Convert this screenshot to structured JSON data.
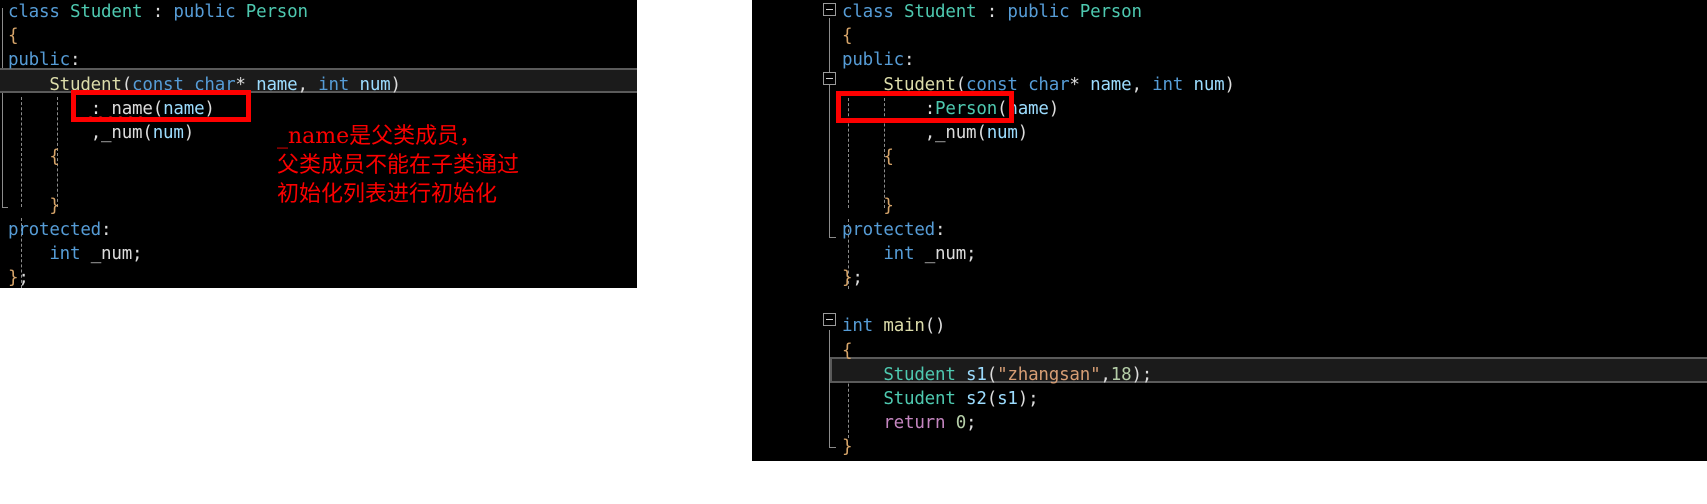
{
  "colors": {
    "background": "#000000",
    "annotation_red": "#fc0000",
    "box_red": "#fe0000",
    "keyword_blue": "#569cd6",
    "type_teal": "#4ec9b0",
    "function_yellow": "#dcdcaa",
    "variable_lightblue": "#9cdcfe",
    "string_orange": "#d69d74",
    "number_green": "#b5cea8",
    "control_purple": "#c586c0",
    "brace_tan": "#d7a56a",
    "plain_text": "#dcdcdc",
    "current_line_border": "#5a5a5a"
  },
  "left_panel": {
    "name": "code-editor-error-version",
    "lines": [
      {
        "indent": 0,
        "tokens": [
          {
            "t": "class",
            "c": "t-key"
          },
          {
            "t": " ",
            "c": "t-white"
          },
          {
            "t": "Student",
            "c": "t-type"
          },
          {
            "t": " ",
            "c": "t-white"
          },
          {
            "t": ":",
            "c": "t-plain"
          },
          {
            "t": " ",
            "c": "t-white"
          },
          {
            "t": "public",
            "c": "t-key"
          },
          {
            "t": " ",
            "c": "t-white"
          },
          {
            "t": "Person",
            "c": "t-type"
          }
        ]
      },
      {
        "indent": 0,
        "tokens": [
          {
            "t": "{",
            "c": "t-brace"
          }
        ]
      },
      {
        "indent": 0,
        "tokens": [
          {
            "t": "public",
            "c": "t-key"
          },
          {
            "t": ":",
            "c": "t-plain"
          }
        ]
      },
      {
        "indent": 0,
        "tokens": [
          {
            "t": "    ",
            "c": "t-white"
          },
          {
            "t": "Student",
            "c": "t-func"
          },
          {
            "t": "(",
            "c": "t-paren"
          },
          {
            "t": "const",
            "c": "t-key"
          },
          {
            "t": " ",
            "c": "t-white"
          },
          {
            "t": "char",
            "c": "t-key"
          },
          {
            "t": "*",
            "c": "t-plain"
          },
          {
            "t": " ",
            "c": "t-white"
          },
          {
            "t": "name",
            "c": "t-var"
          },
          {
            "t": ",",
            "c": "t-plain"
          },
          {
            "t": " ",
            "c": "t-white"
          },
          {
            "t": "int",
            "c": "t-key"
          },
          {
            "t": " ",
            "c": "t-white"
          },
          {
            "t": "num",
            "c": "t-var"
          },
          {
            "t": ")",
            "c": "t-paren"
          }
        ]
      },
      {
        "indent": 0,
        "tokens": [
          {
            "t": "        ",
            "c": "t-white"
          },
          {
            "t": ":",
            "c": "t-plain"
          },
          {
            "t": "_name",
            "c": "t-member"
          },
          {
            "t": "(",
            "c": "t-paren"
          },
          {
            "t": "name",
            "c": "t-var"
          },
          {
            "t": ")",
            "c": "t-paren"
          }
        ]
      },
      {
        "indent": 0,
        "tokens": [
          {
            "t": "        ",
            "c": "t-white"
          },
          {
            "t": ",",
            "c": "t-plain"
          },
          {
            "t": "_num",
            "c": "t-member"
          },
          {
            "t": "(",
            "c": "t-paren"
          },
          {
            "t": "num",
            "c": "t-var"
          },
          {
            "t": ")",
            "c": "t-paren"
          }
        ]
      },
      {
        "indent": 0,
        "tokens": [
          {
            "t": "    ",
            "c": "t-white"
          },
          {
            "t": "{",
            "c": "t-brace"
          }
        ]
      },
      {
        "indent": 0,
        "tokens": [
          {
            "t": "",
            "c": "t-white"
          }
        ]
      },
      {
        "indent": 0,
        "tokens": [
          {
            "t": "    ",
            "c": "t-white"
          },
          {
            "t": "}",
            "c": "t-brace"
          }
        ]
      },
      {
        "indent": 0,
        "tokens": [
          {
            "t": "protected",
            "c": "t-key"
          },
          {
            "t": ":",
            "c": "t-plain"
          }
        ]
      },
      {
        "indent": 0,
        "tokens": [
          {
            "t": "    ",
            "c": "t-white"
          },
          {
            "t": "int",
            "c": "t-key"
          },
          {
            "t": " ",
            "c": "t-white"
          },
          {
            "t": "_num",
            "c": "t-member"
          },
          {
            "t": ";",
            "c": "t-plain"
          }
        ]
      },
      {
        "indent": 0,
        "tokens": [
          {
            "t": "}",
            "c": "t-brace"
          },
          {
            "t": ";",
            "c": "t-plain"
          }
        ]
      }
    ],
    "highlighted_line_index": 3,
    "error_token": "_name",
    "red_box_target_line_index": 4,
    "red_box_target_text": ":_name(name)"
  },
  "annotation": {
    "name": "chinese-error-explanation",
    "line1": "_name是父类成员，",
    "line2": "父类成员不能在子类通过",
    "line3": "初始化列表进行初始化"
  },
  "right_panel": {
    "name": "code-editor-fixed-version",
    "lines": [
      {
        "tokens": [
          {
            "t": "class",
            "c": "t-key"
          },
          {
            "t": " ",
            "c": "t-white"
          },
          {
            "t": "Student",
            "c": "t-type"
          },
          {
            "t": " ",
            "c": "t-white"
          },
          {
            "t": ":",
            "c": "t-plain"
          },
          {
            "t": " ",
            "c": "t-white"
          },
          {
            "t": "public",
            "c": "t-key"
          },
          {
            "t": " ",
            "c": "t-white"
          },
          {
            "t": "Person",
            "c": "t-type"
          }
        ]
      },
      {
        "tokens": [
          {
            "t": "{",
            "c": "t-brace"
          }
        ]
      },
      {
        "tokens": [
          {
            "t": "public",
            "c": "t-key"
          },
          {
            "t": ":",
            "c": "t-plain"
          }
        ]
      },
      {
        "tokens": [
          {
            "t": "    ",
            "c": "t-white"
          },
          {
            "t": "Student",
            "c": "t-func"
          },
          {
            "t": "(",
            "c": "t-paren"
          },
          {
            "t": "const",
            "c": "t-key"
          },
          {
            "t": " ",
            "c": "t-white"
          },
          {
            "t": "char",
            "c": "t-key"
          },
          {
            "t": "*",
            "c": "t-plain"
          },
          {
            "t": " ",
            "c": "t-white"
          },
          {
            "t": "name",
            "c": "t-var"
          },
          {
            "t": ",",
            "c": "t-plain"
          },
          {
            "t": " ",
            "c": "t-white"
          },
          {
            "t": "int",
            "c": "t-key"
          },
          {
            "t": " ",
            "c": "t-white"
          },
          {
            "t": "num",
            "c": "t-var"
          },
          {
            "t": ")",
            "c": "t-paren"
          }
        ]
      },
      {
        "tokens": [
          {
            "t": "        ",
            "c": "t-white"
          },
          {
            "t": ":",
            "c": "t-plain"
          },
          {
            "t": "Person",
            "c": "t-type"
          },
          {
            "t": "(",
            "c": "t-paren"
          },
          {
            "t": "name",
            "c": "t-var"
          },
          {
            "t": ")",
            "c": "t-paren"
          }
        ]
      },
      {
        "tokens": [
          {
            "t": "        ",
            "c": "t-white"
          },
          {
            "t": ",",
            "c": "t-plain"
          },
          {
            "t": "_num",
            "c": "t-member"
          },
          {
            "t": "(",
            "c": "t-paren"
          },
          {
            "t": "num",
            "c": "t-var"
          },
          {
            "t": ")",
            "c": "t-paren"
          }
        ]
      },
      {
        "tokens": [
          {
            "t": "    ",
            "c": "t-white"
          },
          {
            "t": "{",
            "c": "t-brace"
          }
        ]
      },
      {
        "tokens": [
          {
            "t": "",
            "c": "t-white"
          }
        ]
      },
      {
        "tokens": [
          {
            "t": "    ",
            "c": "t-white"
          },
          {
            "t": "}",
            "c": "t-brace"
          }
        ]
      },
      {
        "tokens": [
          {
            "t": "protected",
            "c": "t-key"
          },
          {
            "t": ":",
            "c": "t-plain"
          }
        ]
      },
      {
        "tokens": [
          {
            "t": "    ",
            "c": "t-white"
          },
          {
            "t": "int",
            "c": "t-key"
          },
          {
            "t": " ",
            "c": "t-white"
          },
          {
            "t": "_num",
            "c": "t-member"
          },
          {
            "t": ";",
            "c": "t-plain"
          }
        ]
      },
      {
        "tokens": [
          {
            "t": "}",
            "c": "t-brace"
          },
          {
            "t": ";",
            "c": "t-plain"
          }
        ]
      },
      {
        "tokens": [
          {
            "t": "",
            "c": "t-white"
          }
        ]
      },
      {
        "tokens": [
          {
            "t": "int",
            "c": "t-key"
          },
          {
            "t": " ",
            "c": "t-white"
          },
          {
            "t": "main",
            "c": "t-func"
          },
          {
            "t": "()",
            "c": "t-paren"
          }
        ]
      },
      {
        "tokens": [
          {
            "t": "{",
            "c": "t-brace"
          }
        ]
      },
      {
        "tokens": [
          {
            "t": "    ",
            "c": "t-white"
          },
          {
            "t": "Student",
            "c": "t-type"
          },
          {
            "t": " ",
            "c": "t-white"
          },
          {
            "t": "s1",
            "c": "t-var"
          },
          {
            "t": "(",
            "c": "t-paren"
          },
          {
            "t": "\"zhangsan\"",
            "c": "t-str"
          },
          {
            "t": ",",
            "c": "t-plain"
          },
          {
            "t": "18",
            "c": "t-num"
          },
          {
            "t": ")",
            "c": "t-paren"
          },
          {
            "t": ";",
            "c": "t-plain"
          }
        ]
      },
      {
        "tokens": [
          {
            "t": "    ",
            "c": "t-white"
          },
          {
            "t": "Student",
            "c": "t-type"
          },
          {
            "t": " ",
            "c": "t-white"
          },
          {
            "t": "s2",
            "c": "t-var"
          },
          {
            "t": "(",
            "c": "t-paren"
          },
          {
            "t": "s1",
            "c": "t-var"
          },
          {
            "t": ")",
            "c": "t-paren"
          },
          {
            "t": ";",
            "c": "t-plain"
          }
        ]
      },
      {
        "tokens": [
          {
            "t": "    ",
            "c": "t-white"
          },
          {
            "t": "return",
            "c": "t-ctrl"
          },
          {
            "t": " ",
            "c": "t-white"
          },
          {
            "t": "0",
            "c": "t-num"
          },
          {
            "t": ";",
            "c": "t-plain"
          }
        ]
      },
      {
        "tokens": [
          {
            "t": "}",
            "c": "t-brace"
          }
        ]
      }
    ],
    "selected_line_index": 15,
    "selected_line_text": "Student s1(\"zhangsan\",18);",
    "red_box_target_line_index": 4,
    "red_box_target_text": ":Person(name)",
    "fold_markers": [
      {
        "name": "fold-class-student",
        "line": 0
      },
      {
        "name": "fold-constructor",
        "line": 3
      },
      {
        "name": "fold-main",
        "line": 13
      }
    ]
  }
}
